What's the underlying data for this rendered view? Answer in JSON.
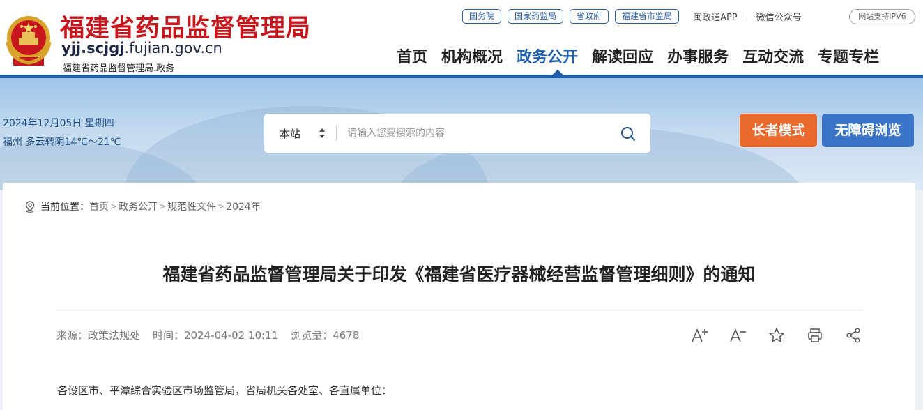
{
  "header": {
    "site_title": "福建省药品监督管理局",
    "domain_prefix": "yjj.scjgj",
    "domain_suffix": ".fujian.gov.cn",
    "site_subtitle": "福建省药品监督管理局.政务",
    "top_links": [
      "国务院",
      "国家药监局",
      "省政府",
      "福建省市监局"
    ],
    "app_link": "闽政通APP",
    "wechat_link": "微信公众号",
    "ipv6_badge": "网站支持IPV6",
    "nav": [
      "首页",
      "机构概况",
      "政务公开",
      "解读回应",
      "办事服务",
      "互动交流",
      "专题专栏"
    ],
    "active_nav": "政务公开"
  },
  "banner": {
    "date": "2024年12月05日 星期四",
    "weather": "福州 多云转阴14℃～21℃",
    "search_scope": "本站",
    "search_placeholder": "请输入您要搜索的内容",
    "elder_mode": "长者模式",
    "accessible_mode": "无障碍浏览"
  },
  "breadcrumb": {
    "label": "当前位置：",
    "items": [
      "首页",
      "政务公开",
      "规范性文件",
      "2024年"
    ]
  },
  "article": {
    "title": "福建省药品监督管理局关于印发《福建省医疗器械经营监督管理细则》的通知",
    "source": "来源：政策法规处",
    "time": "时间：2024-04-02 10:11",
    "views": "浏览量：4678",
    "body_first_line": "各设区市、平潭综合实验区市场监管局，省局机关各处室、各直属单位："
  },
  "colors": {
    "brand_red": "#c8161d",
    "nav_blue": "#1f5fae",
    "elder_orange": "#ea6a2d",
    "access_blue": "#3b74c7"
  }
}
